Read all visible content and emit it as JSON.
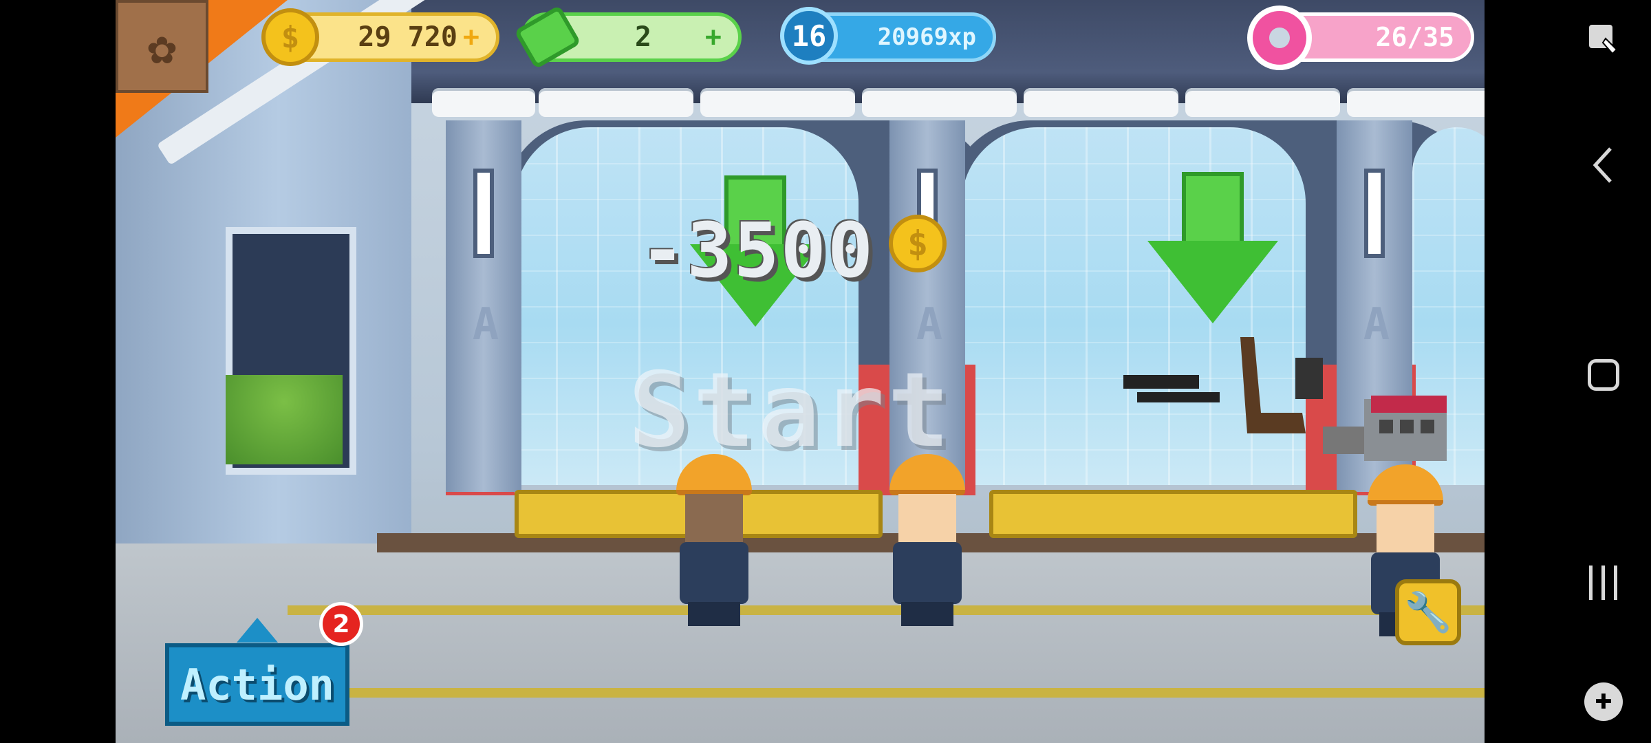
{
  "hud": {
    "coins": "29 720",
    "cash": "2",
    "level": "16",
    "xp": "20969xp",
    "donuts": "26/35",
    "coin_symbol": "$",
    "plus": "+"
  },
  "scene": {
    "cost_text": "-3500",
    "start_text": "Start",
    "pillar_letter": "A"
  },
  "controls": {
    "action_label": "Action",
    "action_badge": "2"
  },
  "colors": {
    "coin": "#f4c21c",
    "cash": "#5ad14a",
    "xp": "#35a8e6",
    "donut": "#f052a0",
    "action": "#1c8fc7"
  },
  "system_nav": {
    "icons": [
      "screenshot-icon",
      "back-icon",
      "home-icon",
      "recents-icon",
      "game-tools-icon"
    ]
  }
}
